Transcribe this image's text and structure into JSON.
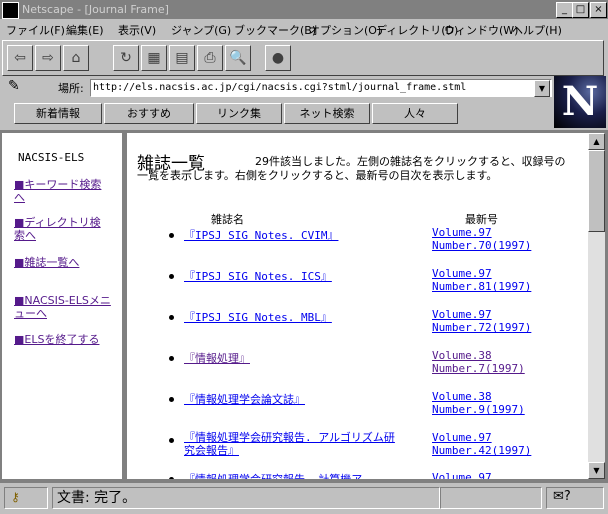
{
  "window": {
    "title": "Netscape - [Journal Frame]"
  },
  "menu": [
    "ファイル(F)",
    "編集(E)",
    "表示(V)",
    "ジャンプ(G)",
    "ブックマーク(B)",
    "オプション(O)",
    "ディレクトリ(D)",
    "ウィンドウ(W)",
    "ヘルプ(H)"
  ],
  "location": {
    "label": "場所:",
    "url": "http://els.nacsis.ac.jp/cgi/nacsis.cgi?stml/journal_frame.stml"
  },
  "dir_buttons": [
    "新着情報",
    "おすすめ",
    "リンク集",
    "ネット検索",
    "人々"
  ],
  "logo": "N",
  "sidebar": {
    "heading": "NACSIS-ELS",
    "items": [
      {
        "label": "■キーワード検索へ"
      },
      {
        "label": "■ディレクトリ検索へ"
      },
      {
        "label": "■雑誌一覧へ"
      },
      {
        "label": "■NACSIS-ELSメニューへ"
      },
      {
        "label": "■ELSを終了する"
      }
    ]
  },
  "main": {
    "title": "雑誌一覧",
    "intro": "29件該当しました。左側の雑誌名をクリックすると、収録号の一覧を表示します。右側をクリックすると、最新号の目次を表示します。",
    "col_journal": "雑誌名",
    "col_latest": "最新号",
    "journals": [
      {
        "name": "『IPSJ SIG Notes. CVIM』",
        "volume": "Volume.97",
        "number": "Number.70(1997)"
      },
      {
        "name": "『IPSJ SIG Notes. ICS』",
        "volume": "Volume.97",
        "number": "Number.81(1997)"
      },
      {
        "name": "『IPSJ SIG Notes. MBL』",
        "volume": "Volume.97",
        "number": "Number.72(1997)"
      },
      {
        "name": "『情報処理』",
        "volume": "Volume.38",
        "number": "Number.7(1997)"
      },
      {
        "name": "『情報処理学会論文誌』",
        "volume": "Volume.38",
        "number": "Number.9(1997)"
      },
      {
        "name": "『情報処理学会研究報告. アルゴリズム研究会報告』",
        "volume": "Volume.97",
        "number": "Number.42(1997)"
      },
      {
        "name": "『情報処理学会研究報告. 計算機ア",
        "volume": "Volume.97",
        "number": ""
      }
    ]
  },
  "status": {
    "text": "文書: 完了。"
  }
}
